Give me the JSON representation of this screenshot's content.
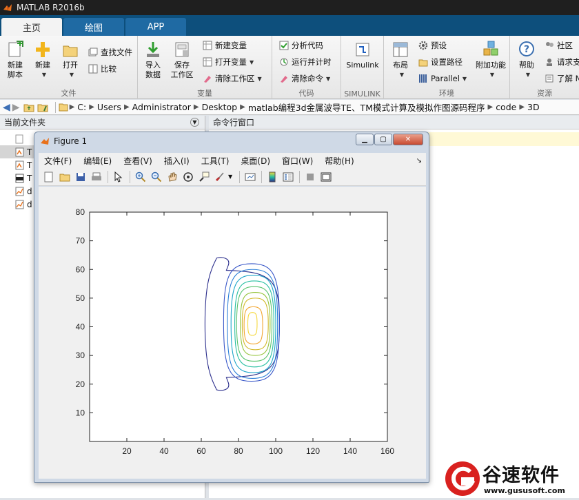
{
  "app": {
    "title": "MATLAB R2016b"
  },
  "tabs": [
    {
      "label": "主页",
      "active": true
    },
    {
      "label": "绘图",
      "active": false
    },
    {
      "label": "APP",
      "active": false
    }
  ],
  "ribbon": {
    "groups": {
      "file": "文件",
      "variable": "变量",
      "code": "代码",
      "simulink": "SIMULINK",
      "env": "环境",
      "resources": "资源"
    },
    "new_script": "新建\n脚本",
    "new": "新建",
    "open": "打开",
    "find_files": "查找文件",
    "compare": "比较",
    "import_data": "导入\n数据",
    "save_workspace": "保存\n工作区",
    "new_variable": "新建变量",
    "open_variable": "打开变量",
    "clear_workspace": "清除工作区",
    "analyze_code": "分析代码",
    "run_time": "运行并计时",
    "clear_commands": "清除命令",
    "simulink": "Simulink",
    "layout": "布局",
    "preferences": "预设",
    "set_path": "设置路径",
    "parallel": "Parallel",
    "addons": "附加功能",
    "help": "帮助",
    "community": "社区",
    "request_support": "请求支",
    "learn": "了解 N"
  },
  "address": {
    "crumbs": [
      "C:",
      "Users",
      "Administrator",
      "Desktop",
      "matlab编程3d金属波导TE、TM模式计算及模拟作图源码程序",
      "code",
      "3D"
    ]
  },
  "panels": {
    "current_folder": "当前文件夹",
    "command_window": "命令行窗口"
  },
  "files": [
    {
      "name": "T",
      "icon": "mfile-icon",
      "selected": true
    },
    {
      "name": "T",
      "icon": "mfile-icon",
      "selected": false
    },
    {
      "name": "T",
      "icon": "jpg-icon",
      "selected": false
    },
    {
      "name": "d",
      "icon": "fig-icon",
      "selected": false
    },
    {
      "name": "d",
      "icon": "fig-icon",
      "selected": false
    }
  ],
  "figure": {
    "title": "Figure 1",
    "menu": [
      "文件(F)",
      "编辑(E)",
      "查看(V)",
      "插入(I)",
      "工具(T)",
      "桌面(D)",
      "窗口(W)",
      "帮助(H)"
    ],
    "window_buttons": [
      "minimize",
      "restore",
      "close"
    ]
  },
  "chart_data": {
    "type": "contour",
    "title": "",
    "xlabel": "",
    "ylabel": "",
    "xlim": [
      0,
      160
    ],
    "ylim": [
      0,
      80
    ],
    "xticks": [
      20,
      40,
      60,
      80,
      100,
      120,
      140,
      160
    ],
    "yticks": [
      10,
      20,
      30,
      40,
      50,
      60,
      70,
      80
    ],
    "center": [
      87,
      41
    ],
    "levels": [
      {
        "level": 1,
        "xmin": 62,
        "xmax": 102,
        "ymin": 18,
        "ymax": 64,
        "color": "#2b2e8c",
        "flanged": true
      },
      {
        "level": 2,
        "xmin": 72,
        "xmax": 102,
        "ymin": 21,
        "ymax": 62,
        "color": "#3a58c8"
      },
      {
        "level": 3,
        "xmin": 74,
        "xmax": 101,
        "ymin": 22,
        "ymax": 60,
        "color": "#2c7fd8"
      },
      {
        "level": 4,
        "xmin": 76,
        "xmax": 100,
        "ymin": 24,
        "ymax": 58,
        "color": "#1da6c9"
      },
      {
        "level": 5,
        "xmin": 78,
        "xmax": 99,
        "ymin": 26,
        "ymax": 56,
        "color": "#27bfa1"
      },
      {
        "level": 6,
        "xmin": 79,
        "xmax": 98,
        "ymin": 28,
        "ymax": 54,
        "color": "#57c26b"
      },
      {
        "level": 7,
        "xmin": 81,
        "xmax": 97,
        "ymin": 30,
        "ymax": 52,
        "color": "#95c43c"
      },
      {
        "level": 8,
        "xmin": 82,
        "xmax": 96,
        "ymin": 32,
        "ymax": 50,
        "color": "#d1b92a"
      },
      {
        "level": 9,
        "xmin": 83,
        "xmax": 93,
        "ymin": 34,
        "ymax": 47,
        "color": "#f2a52f"
      },
      {
        "level": 10,
        "xmin": 85,
        "xmax": 90,
        "ymin": 37,
        "ymax": 45,
        "color": "#f5d73a"
      }
    ]
  },
  "watermark": {
    "brand": "谷速软件",
    "url": "www.gususoft.com"
  }
}
